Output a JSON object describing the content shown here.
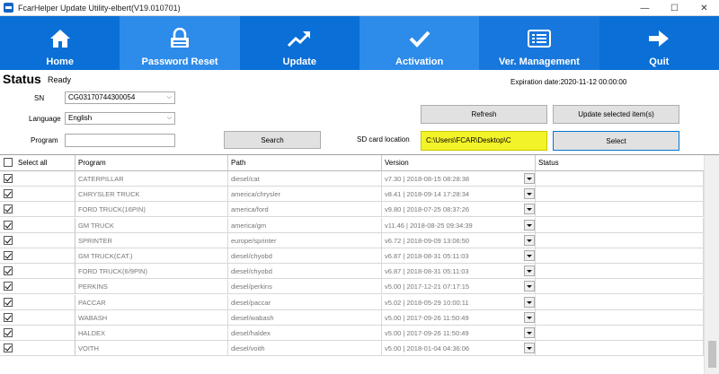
{
  "window": {
    "title": "FcarHelper Update Utility-elbert(V19.010701)",
    "controls": {
      "minimize": "—",
      "maximize": "☐",
      "close": "✕"
    }
  },
  "nav": {
    "items": [
      {
        "label": "Home",
        "icon": "home-icon"
      },
      {
        "label": "Password Reset",
        "icon": "lock-icon"
      },
      {
        "label": "Update",
        "icon": "trend-up-icon"
      },
      {
        "label": "Activation",
        "icon": "checkmark-icon"
      },
      {
        "label": "Ver. Management",
        "icon": "list-icon"
      },
      {
        "label": "Quit",
        "icon": "arrow-right-icon"
      }
    ],
    "colors": {
      "bar": "#0a6fd6",
      "highlight": "#2d8bea"
    }
  },
  "status": {
    "title": "Status",
    "value": "Ready",
    "expiration": "Expiration date:2020-11-12 00:00:00"
  },
  "form": {
    "sn_label": "SN",
    "sn_value": "CG03170744300054",
    "language_label": "Language",
    "language_value": "English",
    "program_label": "Program",
    "program_value": "",
    "search_button": "Search",
    "sd_label": "SD card location",
    "sd_value": "C:\\Users\\FCAR\\Desktop\\C",
    "refresh_button": "Refresh",
    "update_button": "Update selected item(s)",
    "select_button": "Select"
  },
  "table": {
    "select_all": "Select all",
    "columns": [
      "Program",
      "Path",
      "Version",
      "Status"
    ],
    "rows": [
      {
        "program": "CATERPILLAR",
        "path": "diesel/cat",
        "version": "v7.30 | 2018-08-15 08:28:38",
        "status": "",
        "checked": true
      },
      {
        "program": "CHRYSLER TRUCK",
        "path": "america/chrysler",
        "version": "v8.41 | 2018-09-14 17:28:34",
        "status": "",
        "checked": true
      },
      {
        "program": "FORD TRUCK(16PIN)",
        "path": "america/ford",
        "version": "v9.80 | 2018-07-25 08:37:26",
        "status": "",
        "checked": true
      },
      {
        "program": "GM TRUCK",
        "path": "america/gm",
        "version": "v11.46 | 2018-08-25 09:34:39",
        "status": "",
        "checked": true
      },
      {
        "program": "SPRINTER",
        "path": "europe/sprinter",
        "version": "v6.72 | 2018-09-09 13:06:50",
        "status": "",
        "checked": true
      },
      {
        "program": "GM TRUCK(CAT.)",
        "path": "diesel/chyobd",
        "version": "v6.87 | 2018-08-31 05:11:03",
        "status": "",
        "checked": true
      },
      {
        "program": "FORD TRUCK(6/9PIN)",
        "path": "diesel/chyobd",
        "version": "v6.87 | 2018-08-31 05:11:03",
        "status": "",
        "checked": true
      },
      {
        "program": "PERKINS",
        "path": "diesel/perkins",
        "version": "v5.00 | 2017-12-21 07:17:15",
        "status": "",
        "checked": true
      },
      {
        "program": "PACCAR",
        "path": "diesel/paccar",
        "version": "v5.02 | 2018-05-29 10:00:11",
        "status": "",
        "checked": true
      },
      {
        "program": "WABASH",
        "path": "diesel/wabash",
        "version": "v5.00 | 2017-09-26 11:50:49",
        "status": "",
        "checked": true
      },
      {
        "program": "HALDEX",
        "path": "diesel/haldex",
        "version": "v5.00 | 2017-09-26 11:50:49",
        "status": "",
        "checked": true
      },
      {
        "program": "VOITH",
        "path": "diesel/voith",
        "version": "v5.00 | 2018-01-04 04:36:06",
        "status": "",
        "checked": true
      }
    ]
  }
}
